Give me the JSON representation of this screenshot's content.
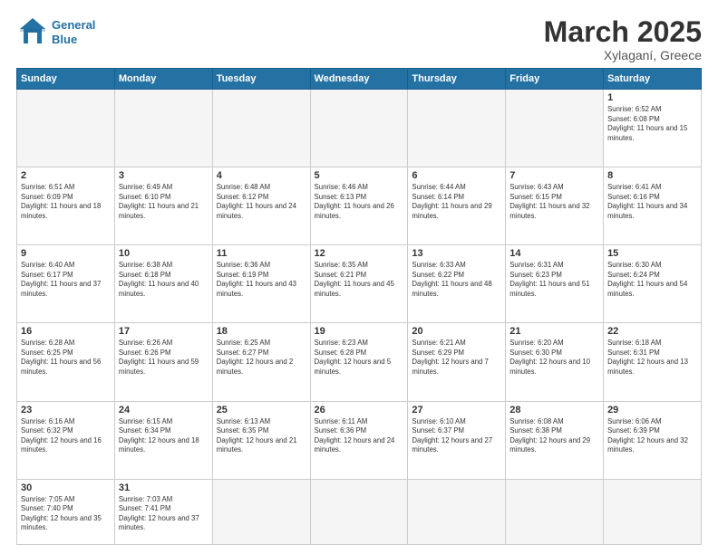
{
  "header": {
    "logo_general": "General",
    "logo_blue": "Blue",
    "month": "March 2025",
    "location": "Xylaganí, Greece"
  },
  "days_of_week": [
    "Sunday",
    "Monday",
    "Tuesday",
    "Wednesday",
    "Thursday",
    "Friday",
    "Saturday"
  ],
  "weeks": [
    [
      {
        "day": "",
        "info": ""
      },
      {
        "day": "",
        "info": ""
      },
      {
        "day": "",
        "info": ""
      },
      {
        "day": "",
        "info": ""
      },
      {
        "day": "",
        "info": ""
      },
      {
        "day": "",
        "info": ""
      },
      {
        "day": "1",
        "info": "Sunrise: 6:52 AM\nSunset: 6:08 PM\nDaylight: 11 hours and 15 minutes."
      }
    ],
    [
      {
        "day": "2",
        "info": "Sunrise: 6:51 AM\nSunset: 6:09 PM\nDaylight: 11 hours and 18 minutes."
      },
      {
        "day": "3",
        "info": "Sunrise: 6:49 AM\nSunset: 6:10 PM\nDaylight: 11 hours and 21 minutes."
      },
      {
        "day": "4",
        "info": "Sunrise: 6:48 AM\nSunset: 6:12 PM\nDaylight: 11 hours and 24 minutes."
      },
      {
        "day": "5",
        "info": "Sunrise: 6:46 AM\nSunset: 6:13 PM\nDaylight: 11 hours and 26 minutes."
      },
      {
        "day": "6",
        "info": "Sunrise: 6:44 AM\nSunset: 6:14 PM\nDaylight: 11 hours and 29 minutes."
      },
      {
        "day": "7",
        "info": "Sunrise: 6:43 AM\nSunset: 6:15 PM\nDaylight: 11 hours and 32 minutes."
      },
      {
        "day": "8",
        "info": "Sunrise: 6:41 AM\nSunset: 6:16 PM\nDaylight: 11 hours and 34 minutes."
      }
    ],
    [
      {
        "day": "9",
        "info": "Sunrise: 6:40 AM\nSunset: 6:17 PM\nDaylight: 11 hours and 37 minutes."
      },
      {
        "day": "10",
        "info": "Sunrise: 6:38 AM\nSunset: 6:18 PM\nDaylight: 11 hours and 40 minutes."
      },
      {
        "day": "11",
        "info": "Sunrise: 6:36 AM\nSunset: 6:19 PM\nDaylight: 11 hours and 43 minutes."
      },
      {
        "day": "12",
        "info": "Sunrise: 6:35 AM\nSunset: 6:21 PM\nDaylight: 11 hours and 45 minutes."
      },
      {
        "day": "13",
        "info": "Sunrise: 6:33 AM\nSunset: 6:22 PM\nDaylight: 11 hours and 48 minutes."
      },
      {
        "day": "14",
        "info": "Sunrise: 6:31 AM\nSunset: 6:23 PM\nDaylight: 11 hours and 51 minutes."
      },
      {
        "day": "15",
        "info": "Sunrise: 6:30 AM\nSunset: 6:24 PM\nDaylight: 11 hours and 54 minutes."
      }
    ],
    [
      {
        "day": "16",
        "info": "Sunrise: 6:28 AM\nSunset: 6:25 PM\nDaylight: 11 hours and 56 minutes."
      },
      {
        "day": "17",
        "info": "Sunrise: 6:26 AM\nSunset: 6:26 PM\nDaylight: 11 hours and 59 minutes."
      },
      {
        "day": "18",
        "info": "Sunrise: 6:25 AM\nSunset: 6:27 PM\nDaylight: 12 hours and 2 minutes."
      },
      {
        "day": "19",
        "info": "Sunrise: 6:23 AM\nSunset: 6:28 PM\nDaylight: 12 hours and 5 minutes."
      },
      {
        "day": "20",
        "info": "Sunrise: 6:21 AM\nSunset: 6:29 PM\nDaylight: 12 hours and 7 minutes."
      },
      {
        "day": "21",
        "info": "Sunrise: 6:20 AM\nSunset: 6:30 PM\nDaylight: 12 hours and 10 minutes."
      },
      {
        "day": "22",
        "info": "Sunrise: 6:18 AM\nSunset: 6:31 PM\nDaylight: 12 hours and 13 minutes."
      }
    ],
    [
      {
        "day": "23",
        "info": "Sunrise: 6:16 AM\nSunset: 6:32 PM\nDaylight: 12 hours and 16 minutes."
      },
      {
        "day": "24",
        "info": "Sunrise: 6:15 AM\nSunset: 6:34 PM\nDaylight: 12 hours and 18 minutes."
      },
      {
        "day": "25",
        "info": "Sunrise: 6:13 AM\nSunset: 6:35 PM\nDaylight: 12 hours and 21 minutes."
      },
      {
        "day": "26",
        "info": "Sunrise: 6:11 AM\nSunset: 6:36 PM\nDaylight: 12 hours and 24 minutes."
      },
      {
        "day": "27",
        "info": "Sunrise: 6:10 AM\nSunset: 6:37 PM\nDaylight: 12 hours and 27 minutes."
      },
      {
        "day": "28",
        "info": "Sunrise: 6:08 AM\nSunset: 6:38 PM\nDaylight: 12 hours and 29 minutes."
      },
      {
        "day": "29",
        "info": "Sunrise: 6:06 AM\nSunset: 6:39 PM\nDaylight: 12 hours and 32 minutes."
      }
    ],
    [
      {
        "day": "30",
        "info": "Sunrise: 7:05 AM\nSunset: 7:40 PM\nDaylight: 12 hours and 35 minutes."
      },
      {
        "day": "31",
        "info": "Sunrise: 7:03 AM\nSunset: 7:41 PM\nDaylight: 12 hours and 37 minutes."
      },
      {
        "day": "",
        "info": ""
      },
      {
        "day": "",
        "info": ""
      },
      {
        "day": "",
        "info": ""
      },
      {
        "day": "",
        "info": ""
      },
      {
        "day": "",
        "info": ""
      }
    ]
  ]
}
